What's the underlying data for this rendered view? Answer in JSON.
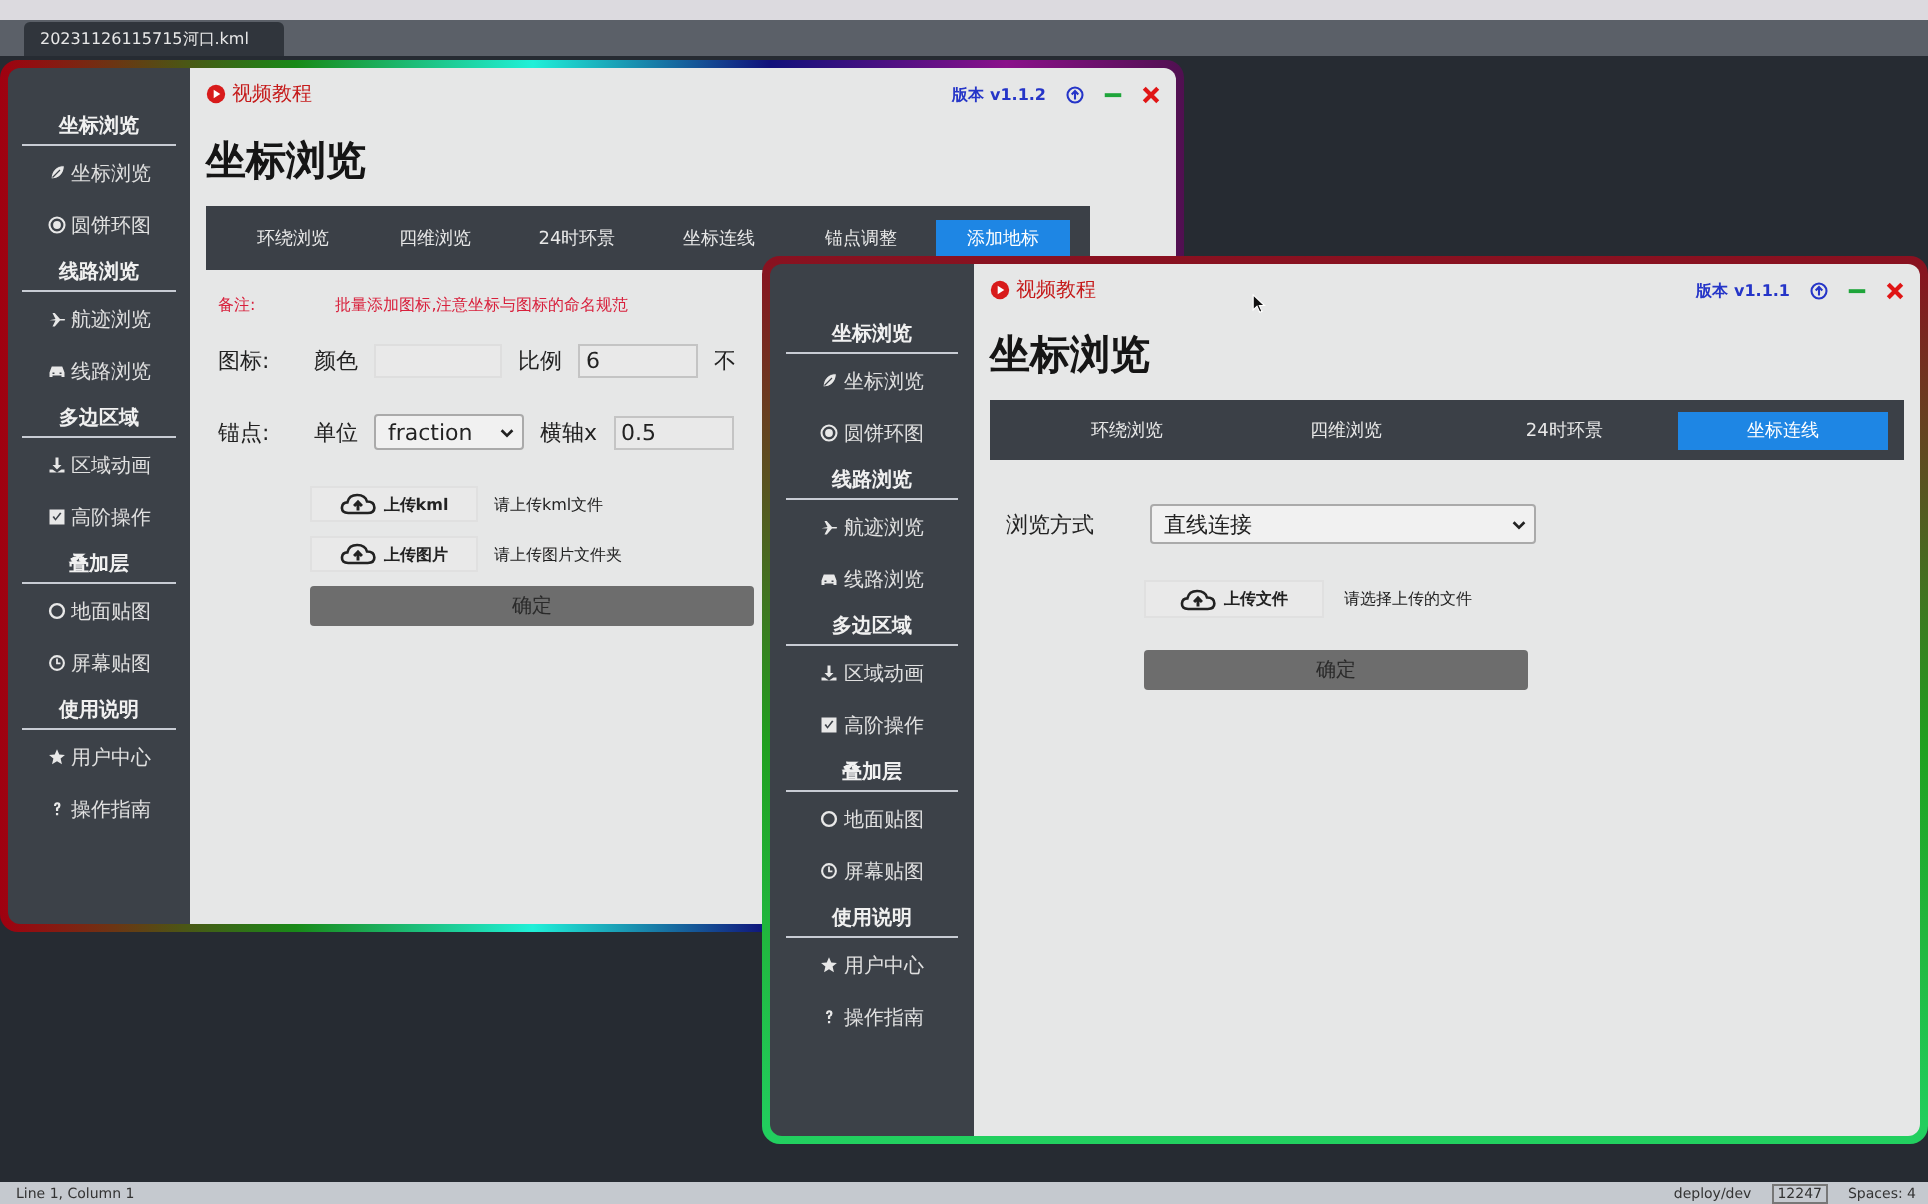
{
  "editor": {
    "tab": "20231126115715河口.kml",
    "status_left": "Line 1, Column 1",
    "branch": "deploy/dev",
    "branch_count": "12247",
    "spaces": "Spaces: 4"
  },
  "windows": [
    {
      "video_link": "视频教程",
      "version": "版本 v1.1.2",
      "title": "坐标浏览",
      "sidebar": [
        {
          "heading": "坐标浏览",
          "items": [
            {
              "label": "坐标浏览"
            },
            {
              "label": "圆饼环图"
            }
          ]
        },
        {
          "heading": "线路浏览",
          "items": [
            {
              "label": "航迹浏览"
            },
            {
              "label": "线路浏览"
            }
          ]
        },
        {
          "heading": "多边区域",
          "items": [
            {
              "label": "区域动画"
            },
            {
              "label": "高阶操作"
            }
          ]
        },
        {
          "heading": "叠加层",
          "items": [
            {
              "label": "地面贴图"
            },
            {
              "label": "屏幕贴图"
            }
          ]
        },
        {
          "heading": "使用说明",
          "items": [
            {
              "label": "用户中心"
            },
            {
              "label": "操作指南"
            }
          ]
        }
      ],
      "tabs": [
        {
          "label": "环绕浏览",
          "selected": false
        },
        {
          "label": "四维浏览",
          "selected": false
        },
        {
          "label": "24时环景",
          "selected": false
        },
        {
          "label": "坐标连线",
          "selected": false
        },
        {
          "label": "锚点调整",
          "selected": false
        },
        {
          "label": "添加地标",
          "selected": true
        }
      ],
      "form": {
        "kind": "icon",
        "note_label": "备注:",
        "note": "批量添加图标,注意坐标与图标的命名规范",
        "icon_label": "图标:",
        "color_label": "颜色",
        "scale_label": "比例",
        "scale_value": "6",
        "opacity_label": "不",
        "anchor_label": "锚点:",
        "unit_label": "单位",
        "unit_value": "fraction",
        "x_label": "横轴x",
        "x_value": "0.5",
        "uploads": [
          {
            "button": "上传kml",
            "hint": "请上传kml文件"
          },
          {
            "button": "上传图片",
            "hint": "请上传图片文件夹"
          }
        ],
        "confirm": "确定"
      }
    },
    {
      "video_link": "视频教程",
      "version": "版本 v1.1.1",
      "title": "坐标浏览",
      "sidebar": [
        {
          "heading": "坐标浏览",
          "items": [
            {
              "label": "坐标浏览"
            },
            {
              "label": "圆饼环图"
            }
          ]
        },
        {
          "heading": "线路浏览",
          "items": [
            {
              "label": "航迹浏览"
            },
            {
              "label": "线路浏览"
            }
          ]
        },
        {
          "heading": "多边区域",
          "items": [
            {
              "label": "区域动画"
            },
            {
              "label": "高阶操作"
            }
          ]
        },
        {
          "heading": "叠加层",
          "items": [
            {
              "label": "地面贴图"
            },
            {
              "label": "屏幕贴图"
            }
          ]
        },
        {
          "heading": "使用说明",
          "items": [
            {
              "label": "用户中心"
            },
            {
              "label": "操作指南"
            }
          ]
        }
      ],
      "tabs": [
        {
          "label": "环绕浏览",
          "selected": false
        },
        {
          "label": "四维浏览",
          "selected": false
        },
        {
          "label": "24时环景",
          "selected": false
        },
        {
          "label": "坐标连线",
          "selected": true
        }
      ],
      "form": {
        "kind": "route",
        "mode_label": "浏览方式",
        "mode_value": "直线连接",
        "uploads": [
          {
            "button": "上传文件",
            "hint": "请选择上传的文件"
          }
        ],
        "confirm": "确定"
      }
    }
  ]
}
